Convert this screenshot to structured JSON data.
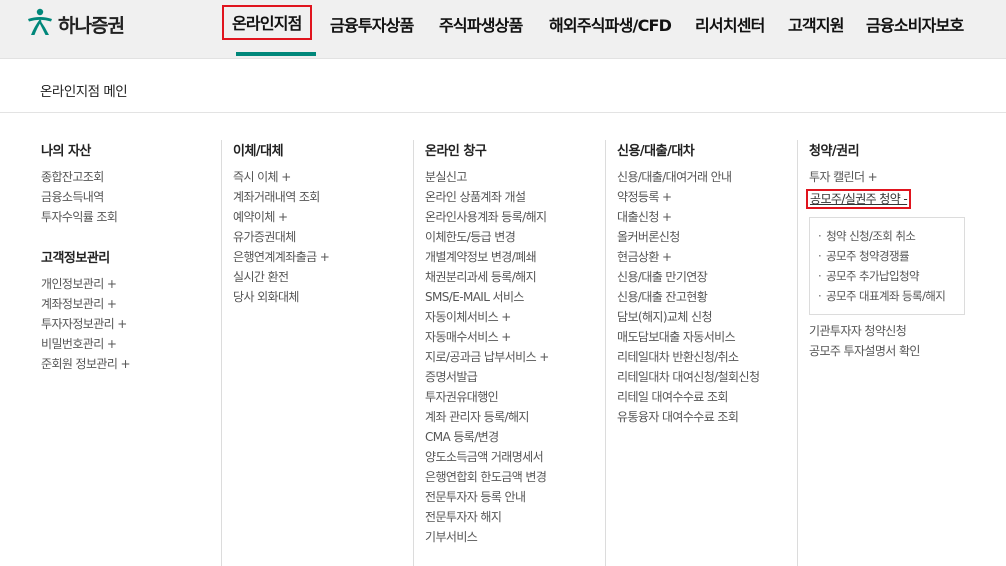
{
  "brand": {
    "name": "하나증권",
    "logo_icon": "hana-logo-icon",
    "logo_color": "#00877a"
  },
  "gnb": {
    "items": [
      {
        "label": "온라인지점",
        "active": true
      },
      {
        "label": "금융투자상품"
      },
      {
        "label": "주식파생상품"
      },
      {
        "label": "해외주식파생/CFD"
      },
      {
        "label": "리서치센터"
      },
      {
        "label": "고객지원"
      },
      {
        "label": "금융소비자보호"
      }
    ]
  },
  "page_title": "온라인지점 메인",
  "columns": [
    {
      "sections": [
        {
          "title": "나의 자산",
          "links": [
            "종합잔고조회",
            "금융소득내역",
            "투자수익률 조회"
          ]
        },
        {
          "title": "고객정보관리",
          "links": [
            "개인정보관리 +",
            "계좌정보관리 +",
            "투자자정보관리 +",
            "비밀번호관리 +",
            "준회원 정보관리 +"
          ]
        }
      ]
    },
    {
      "sections": [
        {
          "title": "이체/대체",
          "links": [
            "즉시 이체 +",
            "계좌거래내역 조회",
            "예약이체 +",
            "유가증권대체",
            "은행연계계좌출금 +",
            "실시간 환전",
            "당사 외화대체"
          ]
        }
      ]
    },
    {
      "sections": [
        {
          "title": "온라인 창구",
          "links": [
            "분실신고",
            "온라인 상품계좌 개설",
            "온라인사용계좌 등록/해지",
            "이체한도/등급 변경",
            "개별계약정보 변경/폐쇄",
            "채권분리과세 등록/해지",
            "SMS/E-MAIL 서비스",
            "자동이체서비스 +",
            "자동매수서비스 +",
            "지로/공과금 납부서비스 +",
            "증명서발급",
            "투자권유대행인",
            "계좌 관리자 등록/해지",
            "CMA 등록/변경",
            "양도소득금액 거래명세서",
            "은행연합회 한도금액 변경",
            "전문투자자 등록 안내",
            "전문투자자 해지",
            "기부서비스"
          ]
        }
      ]
    },
    {
      "sections": [
        {
          "title": "신용/대출/대차",
          "links": [
            "신용/대출/대여거래 안내",
            "약정등록 +",
            "대출신청 +",
            "올커버론신청",
            "현금상환 +",
            "신용/대출 만기연장",
            "신용/대출 잔고현황",
            "담보(해지)교체 신청",
            "매도담보대출 자동서비스",
            "리테일대차 반환신청/취소",
            "리테일대차 대여신청/철회신청",
            "리테일 대여수수료 조회",
            "유통융자 대여수수료 조회"
          ]
        }
      ]
    },
    {
      "sections": [
        {
          "title": "청약/권리",
          "links_before": [
            "투자 캘린더 +"
          ],
          "highlight_link": "공모주/실권주 청약 -",
          "submenu": [
            "청약 신청/조회 취소",
            "공모주 청약경쟁률",
            "공모주 추가납입청약",
            "공모주 대표계좌 등록/해지"
          ],
          "links_after": [
            "기관투자자 청약신청",
            "공모주 투자설명서 확인"
          ]
        }
      ]
    }
  ],
  "colors": {
    "accent": "#00877a",
    "highlight_box": "#e0141e"
  }
}
